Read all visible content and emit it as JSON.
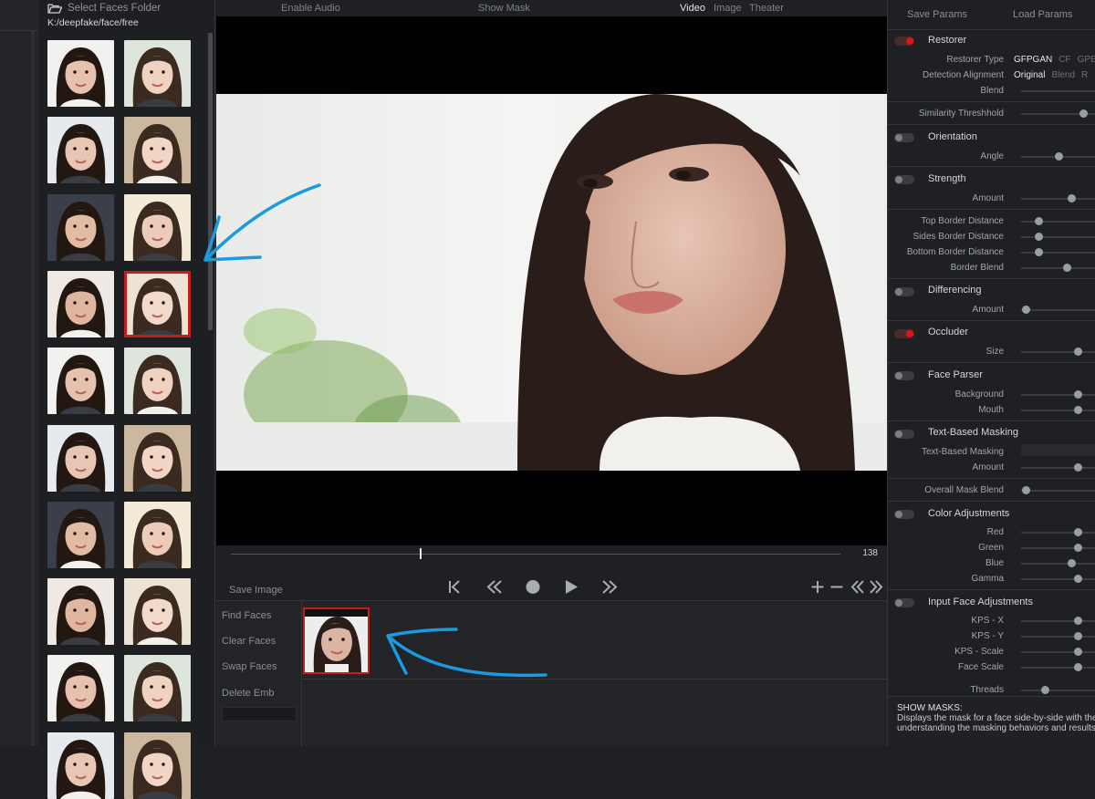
{
  "faces_panel": {
    "select_label": "Select Faces Folder",
    "folder_path": "K:/deepfake/face/free"
  },
  "topbar": {
    "enable_audio": "Enable Audio",
    "show_mask": "Show Mask",
    "video_tab": "Video",
    "image_tab": "Image",
    "theater_tab": "Theater"
  },
  "timeline": {
    "frame_number": "138",
    "progress": 0.31,
    "save_image": "Save Image"
  },
  "bottom": {
    "find_faces": "Find Faces",
    "clear_faces": "Clear Faces",
    "swap_faces": "Swap Faces",
    "delete_emb": "Delete Emb"
  },
  "right_panel": {
    "save_params": "Save Params",
    "load_params": "Load Params",
    "restorer": {
      "title": "Restorer",
      "enabled": true,
      "type_label": "Restorer Type",
      "type_selected": "GFPGAN",
      "type_others": [
        "CF",
        "GPE"
      ],
      "align_label": "Detection Alignment",
      "align_selected": "Original",
      "align_others": [
        "Blend",
        "R"
      ],
      "blend_label": "Blend"
    },
    "similarity_threshold": "Similarity Threshhold",
    "orientation": {
      "title": "Orientation",
      "enabled": false,
      "angle": "Angle"
    },
    "strength": {
      "title": "Strength",
      "enabled": false,
      "amount": "Amount"
    },
    "borders": {
      "top": "Top Border Distance",
      "sides": "Sides Border Distance",
      "bottom": "Bottom Border Distance",
      "blend": "Border Blend"
    },
    "differencing": {
      "title": "Differencing",
      "enabled": false,
      "amount": "Amount"
    },
    "occluder": {
      "title": "Occluder",
      "enabled": true,
      "size": "Size"
    },
    "face_parser": {
      "title": "Face Parser",
      "enabled": false,
      "background": "Background",
      "mouth": "Mouth"
    },
    "text_masking": {
      "title": "Text-Based Masking",
      "enabled": false,
      "label": "Text-Based Masking",
      "amount": "Amount"
    },
    "overall_mask_blend": "Overall Mask Blend",
    "color_adjustments": {
      "title": "Color Adjustments",
      "enabled": false,
      "red": "Red",
      "green": "Green",
      "blue": "Blue",
      "gamma": "Gamma"
    },
    "input_face_adjustments": {
      "title": "Input Face Adjustments",
      "enabled": false,
      "kps_x": "KPS - X",
      "kps_y": "KPS - Y",
      "kps_scale": "KPS - Scale",
      "face_scale": "Face Scale"
    },
    "threads": "Threads",
    "show_masks": {
      "heading": "SHOW MASKS:",
      "line1": "Displays the mask for a face side-by-side with the",
      "line2": "understanding the masking behaviors and results"
    }
  },
  "colors": {
    "accent_red": "#c51c1c",
    "toggle_on": "#e01414",
    "annotation_blue": "#1a9be0"
  }
}
